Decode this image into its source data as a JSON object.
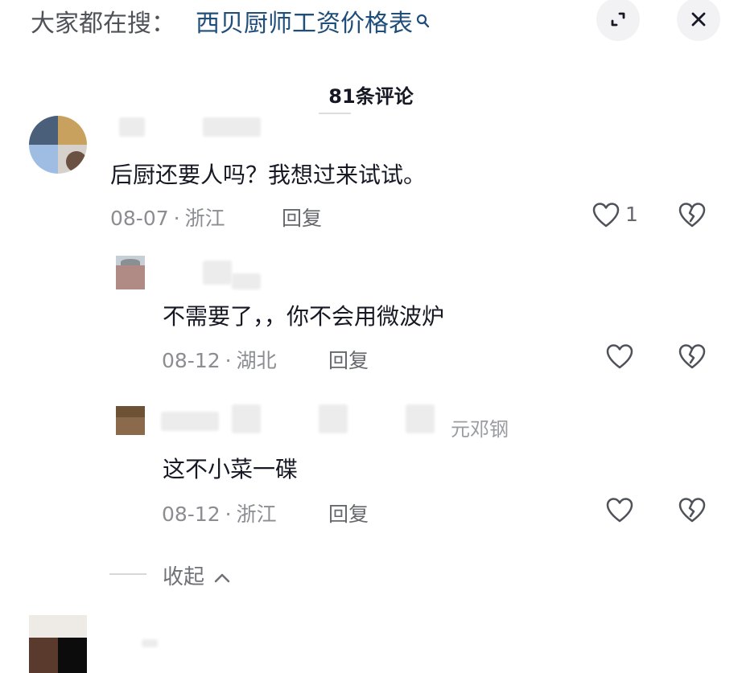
{
  "search_bar": {
    "prefix": "大家都在搜：",
    "term": "西贝厨师工资价格表"
  },
  "icons": {
    "search": "search-icon",
    "expand": "expand-icon",
    "close": "close-icon",
    "like": "heart-icon",
    "dislike": "broken-heart-icon",
    "collapse": "chevron-up-icon"
  },
  "comment_count": "81条评论",
  "comments": [
    {
      "text": "后厨还要人吗？我想过来试试。",
      "date": "08-07",
      "location": "浙江",
      "reply_label": "回复",
      "like_count": "1",
      "replies": [
        {
          "text": "不需要了，，你不会用微波炉",
          "date": "08-12",
          "location": "湖北",
          "reply_label": "回复"
        },
        {
          "partial_name": "元邓钢",
          "text": "这不小菜一碟",
          "date": "08-12",
          "location": "浙江",
          "reply_label": "回复"
        }
      ],
      "collapse_label": "收起"
    }
  ],
  "meta_separator": "·",
  "colors": {
    "search_term": "#1f4e7a",
    "primary_text": "#161823",
    "secondary_text": "#8b8d92",
    "button_bg": "#f2f2f4"
  }
}
